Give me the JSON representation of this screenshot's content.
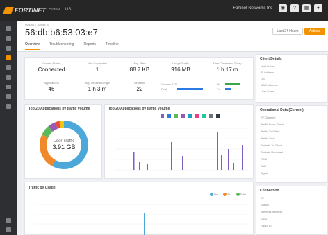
{
  "topbar": {
    "brand": "FORTINET",
    "crumbs": [
      "Home",
      "US"
    ],
    "org": "Fortinet Networks Inc",
    "icons": [
      "bell-icon",
      "help-icon",
      "apps-icon",
      "user-icon"
    ]
  },
  "sidebar": {
    "icons": [
      "dashboard-icon",
      "monitor-icon",
      "wifi-icon",
      "home-icon",
      "devices-icon",
      "settings-icon",
      "alerts-icon",
      "reports-icon",
      "tools-icon"
    ],
    "active_index": 3,
    "bottom_icons": [
      "collapse-icon",
      "feedback-icon"
    ]
  },
  "header": {
    "breadcrumb": "Wired Clients >",
    "title": "56:db:b6:53:03:e7",
    "tabs": [
      "Overview",
      "Troubleshooting",
      "Reports",
      "Timeline"
    ],
    "active_tab": 0,
    "range_button": "Last 24 Hours",
    "actions_button": "Actions"
  },
  "stats": [
    {
      "label": "Current Status",
      "value": "Connected"
    },
    {
      "label": "Mbr Connected",
      "value": "1"
    },
    {
      "label": "Avg. Rate",
      "value": "88.7 KB"
    },
    {
      "label": "Usage Traffic",
      "value": "916 MB"
    },
    {
      "label": "Time Connected Today",
      "value": "1 h 17 m"
    },
    {
      "label": "Applications",
      "value": "46"
    },
    {
      "label": "Avg. Session Length",
      "value": "1 h 3 m"
    },
    {
      "label": "Sessions",
      "value": "22"
    }
  ],
  "usage_legend": [
    "Current: 1.7k",
    "Peak",
    "Rx",
    "Tx"
  ],
  "panels": {
    "donut_title": "Top 20 Applications by traffic volume",
    "bars_title": "Top 20 Applications by traffic volume",
    "traffic_title": "Traffic by Usage",
    "details_title": "Client Details",
    "op_title": "Operational Data (Current)",
    "conn_title": "Connection"
  },
  "donut": {
    "center_label": "User Traffic",
    "center_value": "3.91 GB",
    "segments": [
      {
        "value": 58,
        "color": "#4da8da"
      },
      {
        "value": 24,
        "color": "#f0892a"
      },
      {
        "value": 7,
        "color": "#5cb85c"
      },
      {
        "value": 5,
        "color": "#9b59b6"
      },
      {
        "value": 3,
        "color": "#e74c3c"
      },
      {
        "value": 3,
        "color": "#f1c40f"
      }
    ]
  },
  "traffic_legend": [
    {
      "label": "Rx",
      "color": "#4da8da"
    },
    {
      "label": "Tx",
      "color": "#f0892a"
    },
    {
      "label": "Total",
      "color": "#5cb85c"
    }
  ],
  "client_details": [
    {
      "label": "Host Name",
      "value": "",
      "style": ""
    },
    {
      "label": "IP Address",
      "value": "",
      "style": ""
    },
    {
      "label": "OS",
      "value": "",
      "style": ""
    },
    {
      "label": "MAC Address",
      "value": "",
      "style": ""
    },
    {
      "label": "User Name",
      "value": "",
      "style": ""
    }
  ],
  "operational": [
    {
      "label": "RF Channel",
      "value": "",
      "style": ""
    },
    {
      "label": "Traffic From Client",
      "value": "",
      "style": ""
    },
    {
      "label": "Traffic To Client",
      "value": "",
      "style": ""
    },
    {
      "label": "Traffic Total",
      "value": "",
      "style": ""
    },
    {
      "label": "Packets To Client",
      "value": "",
      "style": ""
    },
    {
      "label": "Packets Received",
      "value": "",
      "style": ""
    },
    {
      "label": "RSSI",
      "value": "",
      "style": ""
    },
    {
      "label": "SNR",
      "value": "",
      "style": "green"
    },
    {
      "label": "Signal",
      "value": "",
      "style": "green"
    }
  ],
  "connection": [
    {
      "label": "AP",
      "value": "",
      "style": "blue"
    },
    {
      "label": "Switch",
      "value": "",
      "style": "blue"
    },
    {
      "label": "Wireless Network",
      "value": "",
      "style": "blue"
    },
    {
      "label": "SSID",
      "value": "",
      "style": ""
    },
    {
      "label": "Radio ID",
      "value": "",
      "style": ""
    }
  ]
}
